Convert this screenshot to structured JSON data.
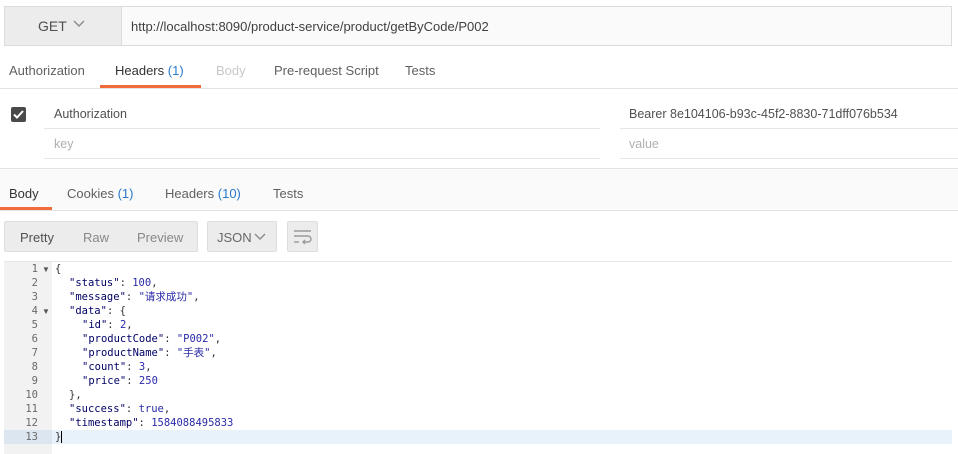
{
  "request": {
    "method": "GET",
    "url": "http://localhost:8090/product-service/product/getByCode/P002"
  },
  "request_tabs": [
    {
      "label": "Authorization"
    },
    {
      "label": "Headers",
      "count": "(1)"
    },
    {
      "label": "Body"
    },
    {
      "label": "Pre-request Script"
    },
    {
      "label": "Tests"
    }
  ],
  "headers_table": {
    "rows": [
      {
        "key": "Authorization",
        "value": "Bearer 8e104106-b93c-45f2-8830-71dff076b534",
        "checked": true
      }
    ],
    "key_placeholder": "key",
    "value_placeholder": "value"
  },
  "response_tabs": [
    {
      "label": "Body"
    },
    {
      "label": "Cookies",
      "count": "(1)"
    },
    {
      "label": "Headers",
      "count": "(10)"
    },
    {
      "label": "Tests"
    }
  ],
  "format_buttons": [
    "Pretty",
    "Raw",
    "Preview"
  ],
  "format_select": "JSON",
  "icons": {
    "method_dropdown": "chevron-down-icon",
    "checkbox": "check-icon",
    "format_dropdown": "chevron-down-icon",
    "wrap": "wrap-lines-icon",
    "fold": "fold-arrow-icon"
  },
  "colors": {
    "accent": "#f26b3a",
    "count": "#2a7ac9"
  },
  "code": {
    "line_numbers": [
      "1",
      "2",
      "3",
      "4",
      "5",
      "6",
      "7",
      "8",
      "9",
      "10",
      "11",
      "12",
      "13"
    ],
    "lines": [
      {
        "t": "{"
      },
      {
        "k": "\"status\"",
        "s": ": ",
        "v": "100",
        "e": ","
      },
      {
        "k": "\"message\"",
        "s": ": ",
        "v": "\"请求成功\"",
        "e": ","
      },
      {
        "k": "\"data\"",
        "s": ": ",
        "v": "{",
        "e": ""
      },
      {
        "k": "\"id\"",
        "s": ": ",
        "v": "2",
        "e": ","
      },
      {
        "k": "\"productCode\"",
        "s": ": ",
        "v": "\"P002\"",
        "e": ","
      },
      {
        "k": "\"productName\"",
        "s": ": ",
        "v": "\"手表\"",
        "e": ","
      },
      {
        "k": "\"count\"",
        "s": ": ",
        "v": "3",
        "e": ","
      },
      {
        "k": "\"price\"",
        "s": ": ",
        "v": "250",
        "e": ""
      },
      {
        "t": "},"
      },
      {
        "k": "\"success\"",
        "s": ": ",
        "v": "true",
        "e": ","
      },
      {
        "k": "\"timestamp\"",
        "s": ": ",
        "v": "1584088495833",
        "e": ""
      },
      {
        "t": "}"
      }
    ]
  }
}
